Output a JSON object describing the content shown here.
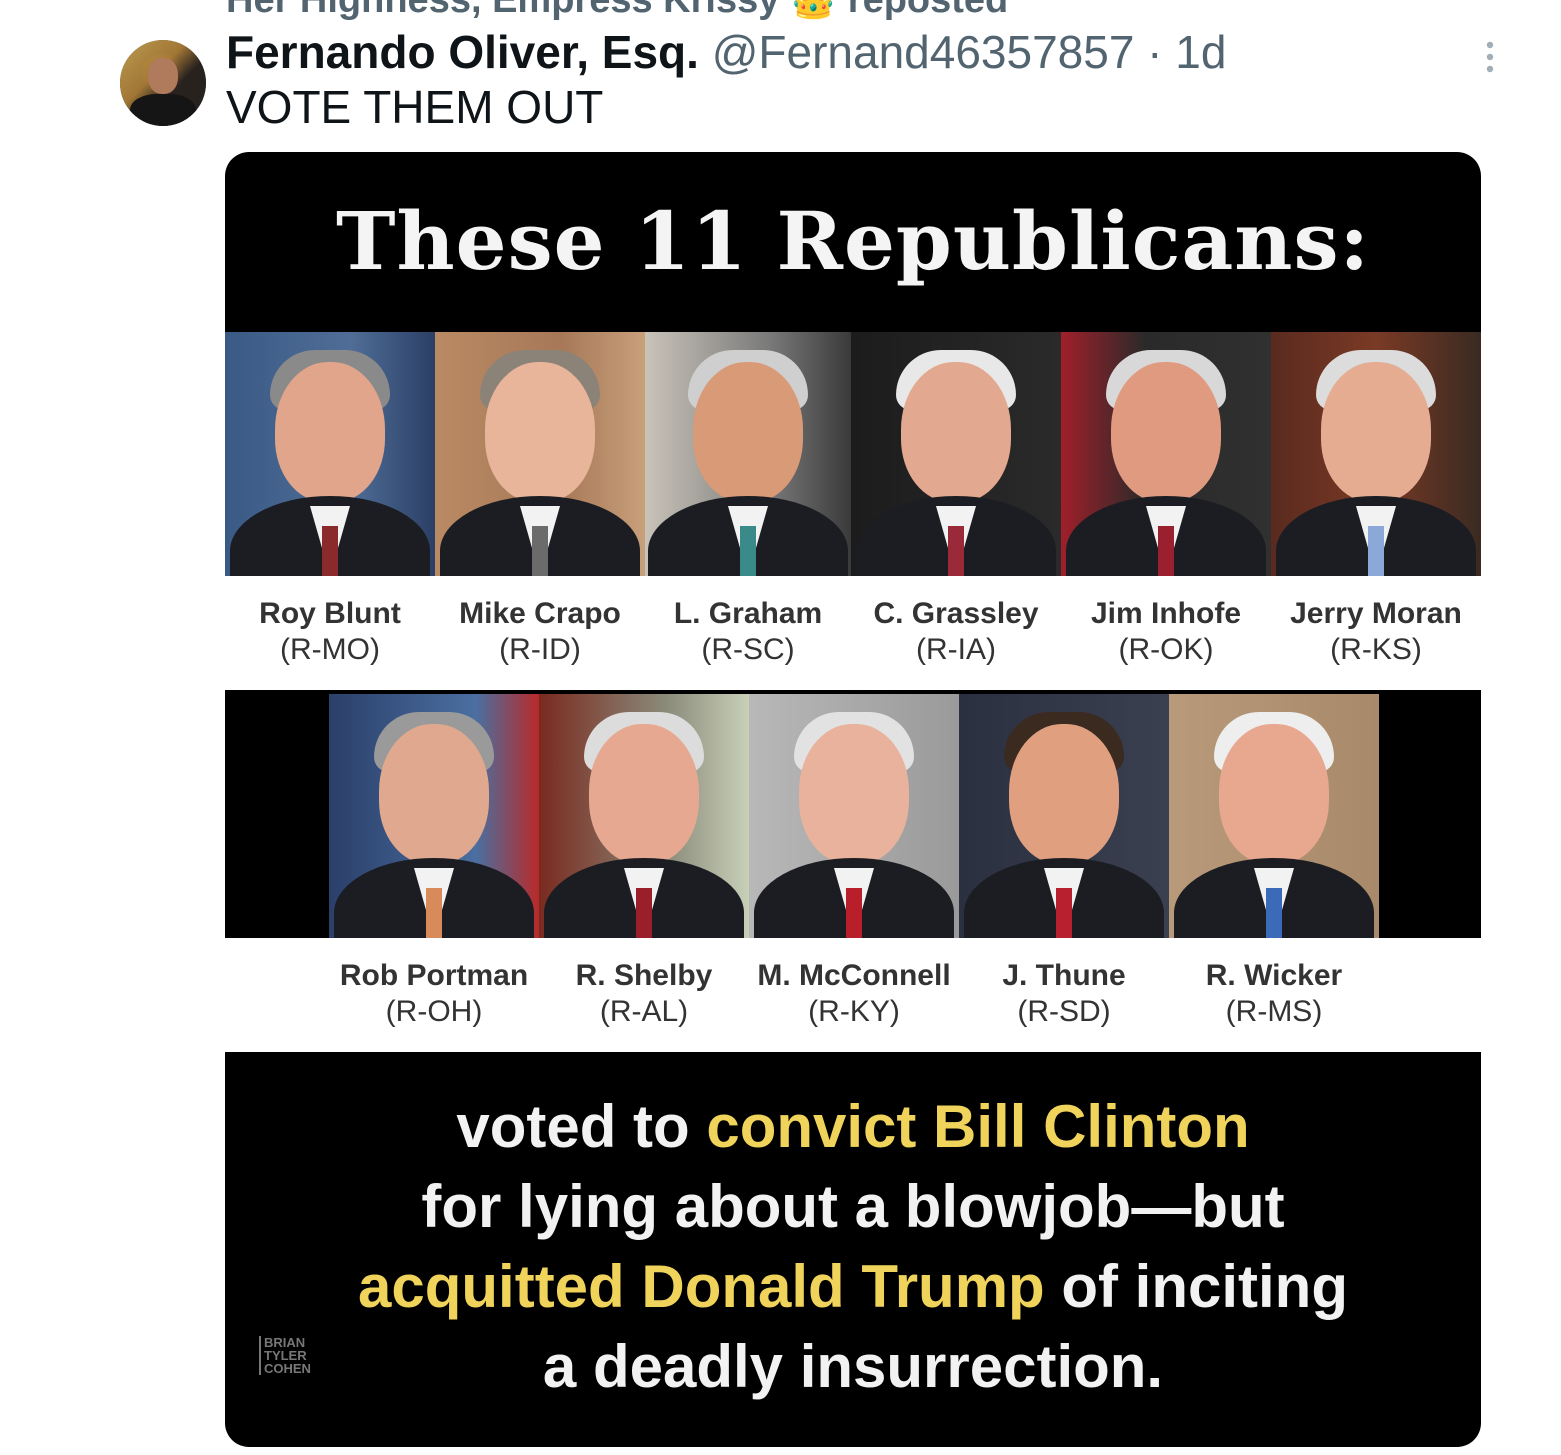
{
  "repost": {
    "text": "Her Highness, Empress Krissy 👑 reposted"
  },
  "tweet": {
    "author_name": "Fernando Oliver, Esq.",
    "handle": "@Fernand46357857",
    "separator": " · ",
    "time": "1d",
    "text": "VOTE THEM OUT",
    "more_icon": "more-vertical-icon"
  },
  "media": {
    "title": "These 11 Republicans:",
    "row1": [
      {
        "name": "Roy Blunt",
        "state": "(R-MO)"
      },
      {
        "name": "Mike Crapo",
        "state": "(R-ID)"
      },
      {
        "name": "L. Graham",
        "state": "(R-SC)"
      },
      {
        "name": "C. Grassley",
        "state": "(R-IA)"
      },
      {
        "name": "Jim Inhofe",
        "state": "(R-OK)"
      },
      {
        "name": "Jerry Moran",
        "state": "(R-KS)"
      }
    ],
    "row2": [
      {
        "name": "Rob Portman",
        "state": "(R-OH)"
      },
      {
        "name": "R. Shelby",
        "state": "(R-AL)"
      },
      {
        "name": "M. McConnell",
        "state": "(R-KY)"
      },
      {
        "name": "J. Thune",
        "state": "(R-SD)"
      },
      {
        "name": "R. Wicker",
        "state": "(R-MS)"
      }
    ],
    "bottom": {
      "p1": "voted to ",
      "p2": "convict Bill Clinton",
      "p3": "for lying about a blowjob—but",
      "p4": "acquitted Donald Trump",
      "p5": " of inciting",
      "p6": "a deadly insurrection."
    },
    "watermark": [
      "BRIAN",
      "TYLER",
      "COHEN"
    ],
    "colors": {
      "highlight": "#f0d35a",
      "background": "#000000"
    }
  }
}
